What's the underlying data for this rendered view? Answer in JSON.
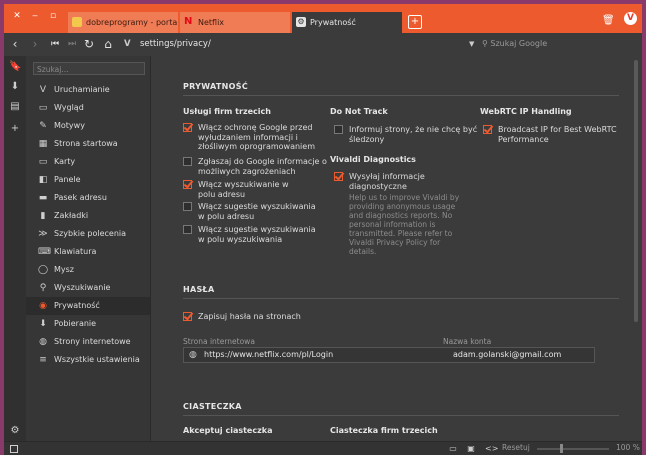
{
  "tabs": [
    {
      "label": "dobreprogramy - portal n",
      "icon": "dobreprogramy-favicon",
      "active": false
    },
    {
      "label": "Netflix",
      "icon": "netflix-favicon",
      "active": false
    },
    {
      "label": "Prywatność",
      "icon": "gear-favicon",
      "active": true
    }
  ],
  "address": {
    "url": "settings/privacy/",
    "search_placeholder": "Szukaj Google",
    "vivaldi_logo": "V",
    "menu_logo": "V"
  },
  "sidebar": {
    "search_placeholder": "Szukaj...",
    "items": [
      {
        "label": "Uruchamianie",
        "icon": "vivaldi-v-icon"
      },
      {
        "label": "Wygląd",
        "icon": "appearance-icon"
      },
      {
        "label": "Motywy",
        "icon": "brush-icon"
      },
      {
        "label": "Strona startowa",
        "icon": "grid-icon"
      },
      {
        "label": "Karty",
        "icon": "tabs-icon"
      },
      {
        "label": "Panele",
        "icon": "panel-icon"
      },
      {
        "label": "Pasek adresu",
        "icon": "address-bar-icon"
      },
      {
        "label": "Zakładki",
        "icon": "bookmark-icon"
      },
      {
        "label": "Szybkie polecenia",
        "icon": "quick-commands-icon"
      },
      {
        "label": "Klawiatura",
        "icon": "keyboard-icon"
      },
      {
        "label": "Mysz",
        "icon": "mouse-icon"
      },
      {
        "label": "Wyszukiwanie",
        "icon": "search-icon"
      },
      {
        "label": "Prywatność",
        "icon": "eye-icon",
        "active": true
      },
      {
        "label": "Pobieranie",
        "icon": "download-icon"
      },
      {
        "label": "Strony internetowe",
        "icon": "globe-icon"
      },
      {
        "label": "Wszystkie ustawienia",
        "icon": "settings-list-icon"
      }
    ]
  },
  "privacy": {
    "title": "PRYWATNOŚĆ",
    "third_party": {
      "heading": "Usługi firm trzecich",
      "options": [
        {
          "label": "Włącz ochronę Google przed wyłudzaniem informacji i złośliwym oprogramowaniem",
          "checked": true
        },
        {
          "label": "Zgłaszaj do Google informacje o możliwych zagrożeniach",
          "checked": false
        },
        {
          "label": "Włącz wyszukiwanie w polu adresu",
          "checked": true
        },
        {
          "label": "Włącz sugestie wyszukiwania w polu adresu",
          "checked": false
        },
        {
          "label": "Włącz sugestie wyszukiwania w polu wyszukiwania",
          "checked": false
        }
      ]
    },
    "dnt": {
      "heading": "Do Not Track",
      "option": {
        "label": "Informuj strony, że nie chcę być śledzony",
        "checked": false
      }
    },
    "diagnostics": {
      "heading": "Vivaldi Diagnostics",
      "option": {
        "label": "Wysyłaj informacje diagnostyczne",
        "checked": true
      },
      "note": "Help us to improve Vivaldi by providing anonymous usage and diagnostics reports. No personal information is transmitted. Please refer to Vivaldi Privacy Policy for details."
    },
    "webrtc": {
      "heading": "WebRTC IP Handling",
      "option": {
        "label": "Broadcast IP for Best WebRTC Performance",
        "checked": true
      }
    }
  },
  "passwords": {
    "title": "HASŁA",
    "save_option": {
      "label": "Zapisuj hasła na stronach",
      "checked": true
    },
    "col_site": "Strona internetowa",
    "col_account": "Nazwa konta",
    "entries": [
      {
        "site": "https://www.netflix.com/pl/Login",
        "account": "adam.golanski@gmail.com"
      }
    ]
  },
  "cookies": {
    "title": "CIASTECZKA",
    "accept_heading": "Akceptuj ciasteczka",
    "third_party_heading": "Ciasteczka firm trzecich"
  },
  "statusbar": {
    "reset_label": "Resetuj",
    "zoom": "100 %",
    "zoom_level": 1.0
  },
  "colors": {
    "accent": "#ec5a2e",
    "panel_bg": "#3b3b3b",
    "sidebar_bg": "#363636"
  }
}
